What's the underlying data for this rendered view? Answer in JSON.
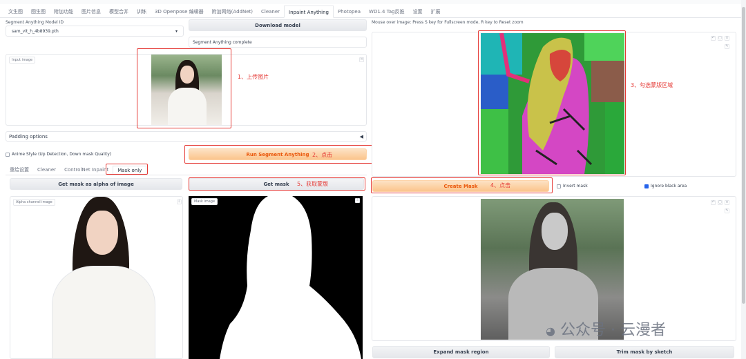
{
  "tabs": [
    "文生图",
    "图生图",
    "附加功能",
    "图片信息",
    "模型合并",
    "训练",
    "3D Openpose 编辑器",
    "附加网络(AddNet)",
    "Cleaner",
    "Inpaint Anything",
    "Photopea",
    "WD1.4 Tag反推",
    "设置",
    "扩展"
  ],
  "active_tab": "Inpaint Anything",
  "left": {
    "model_label": "Segment Anything Model ID",
    "model_value": "sam_vit_h_4b8939.pth",
    "download_button": "Download model",
    "status_text": "Segment Anything complete",
    "input_image_tag": "Input image",
    "padding_options": "Padding options",
    "anime_style_label": "Anime Style (Up Detection, Down mask Quality)",
    "run_button": "Run Segment Anything",
    "subtabs": [
      "重绘设置",
      "Cleaner",
      "ControlNet Inpaint",
      "Mask only"
    ],
    "active_subtab": "Mask only",
    "alpha_button": "Get mask as alpha of image",
    "get_mask_button": "Get mask",
    "alpha_tag": "Alpha channel image",
    "mask_tag": "Mask image"
  },
  "right": {
    "hint": "Mouse over image: Press  S  key for Fullscreen mode,  R  key to Reset zoom",
    "create_mask_button": "Create Mask",
    "invert_mask_label": "Invert mask",
    "ignore_black_label": "Ignore black area",
    "ignore_black_checked": true,
    "expand_button": "Expand mask region",
    "trim_button": "Trim mask by sketch"
  },
  "annotations": {
    "step1": "1、上传图片",
    "step2": "2、点击",
    "step3": "3、勾选蒙版区域",
    "step4": "4、点击",
    "step5": "5、获取蒙版"
  },
  "watermark": "公众号 · 云漫者",
  "colors": {
    "accent_red": "#e53935",
    "orange_text": "#ea580c",
    "checkbox_blue": "#2563eb"
  }
}
